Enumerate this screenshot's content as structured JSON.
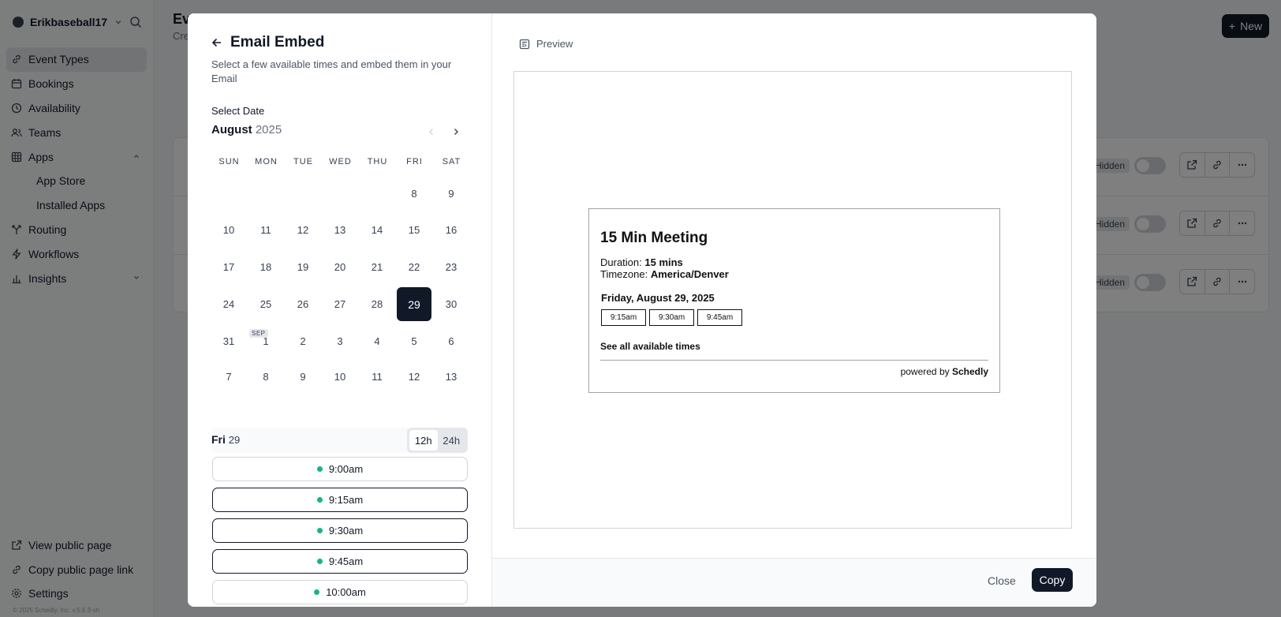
{
  "sidebar": {
    "username": "Erikbaseball17",
    "items": [
      {
        "label": "Event Types",
        "icon": "link-icon"
      },
      {
        "label": "Bookings",
        "icon": "calendar-icon"
      },
      {
        "label": "Availability",
        "icon": "clock-icon"
      },
      {
        "label": "Teams",
        "icon": "users-icon"
      },
      {
        "label": "Apps",
        "icon": "grid-icon"
      },
      {
        "label": "App Store"
      },
      {
        "label": "Installed Apps"
      },
      {
        "label": "Routing",
        "icon": "split-icon"
      },
      {
        "label": "Workflows",
        "icon": "zap-icon"
      },
      {
        "label": "Insights",
        "icon": "bar-chart-icon"
      }
    ],
    "bottom": [
      {
        "label": "View public page",
        "icon": "external-link-icon"
      },
      {
        "label": "Copy public page link",
        "icon": "copy-icon"
      },
      {
        "label": "Settings",
        "icon": "gear-icon"
      }
    ],
    "copyright": "© 2025 Schedly, Inc. v.5.6.3-sh"
  },
  "main": {
    "title": "Ev",
    "subtitle": "Cre",
    "new_label": "New",
    "hidden_label": "Hidden"
  },
  "modal": {
    "title": "Email Embed",
    "description": "Select a few available times and embed them in your Email",
    "select_date_label": "Select Date",
    "month": "August",
    "year": "2025",
    "weekdays": [
      "SUN",
      "MON",
      "TUE",
      "WED",
      "THU",
      "FRI",
      "SAT"
    ],
    "weeks": [
      [
        "",
        "",
        "",
        "",
        "",
        "8",
        "9"
      ],
      [
        "10",
        "11",
        "12",
        "13",
        "14",
        "15",
        "16"
      ],
      [
        "17",
        "18",
        "19",
        "20",
        "21",
        "22",
        "23"
      ],
      [
        "24",
        "25",
        "26",
        "27",
        "28",
        "29",
        "30"
      ],
      [
        "31",
        "1",
        "2",
        "3",
        "4",
        "5",
        "6"
      ],
      [
        "7",
        "8",
        "9",
        "10",
        "11",
        "12",
        "13"
      ]
    ],
    "selected_day": "29",
    "today_day": "28",
    "next_month_tag": "SEP",
    "slot_day_name": "Fri",
    "slot_day_num": "29",
    "format_12h": "12h",
    "format_24h": "24h",
    "slots": [
      {
        "time": "9:00am",
        "selected": false
      },
      {
        "time": "9:15am",
        "selected": true
      },
      {
        "time": "9:30am",
        "selected": true
      },
      {
        "time": "9:45am",
        "selected": true
      },
      {
        "time": "10:00am",
        "selected": false
      }
    ],
    "preview_label": "Preview",
    "email": {
      "title": "15 Min Meeting",
      "duration_label": "Duration:",
      "duration_value": "15 mins",
      "timezone_label": "Timezone:",
      "timezone_value": "America/Denver",
      "date": "Friday, August 29, 2025",
      "times": [
        "9:15am",
        "9:30am",
        "9:45am"
      ],
      "see_all": "See all available times",
      "powered_prefix": "powered by",
      "powered_brand": "Schedly"
    },
    "close_label": "Close",
    "copy_label": "Copy"
  }
}
